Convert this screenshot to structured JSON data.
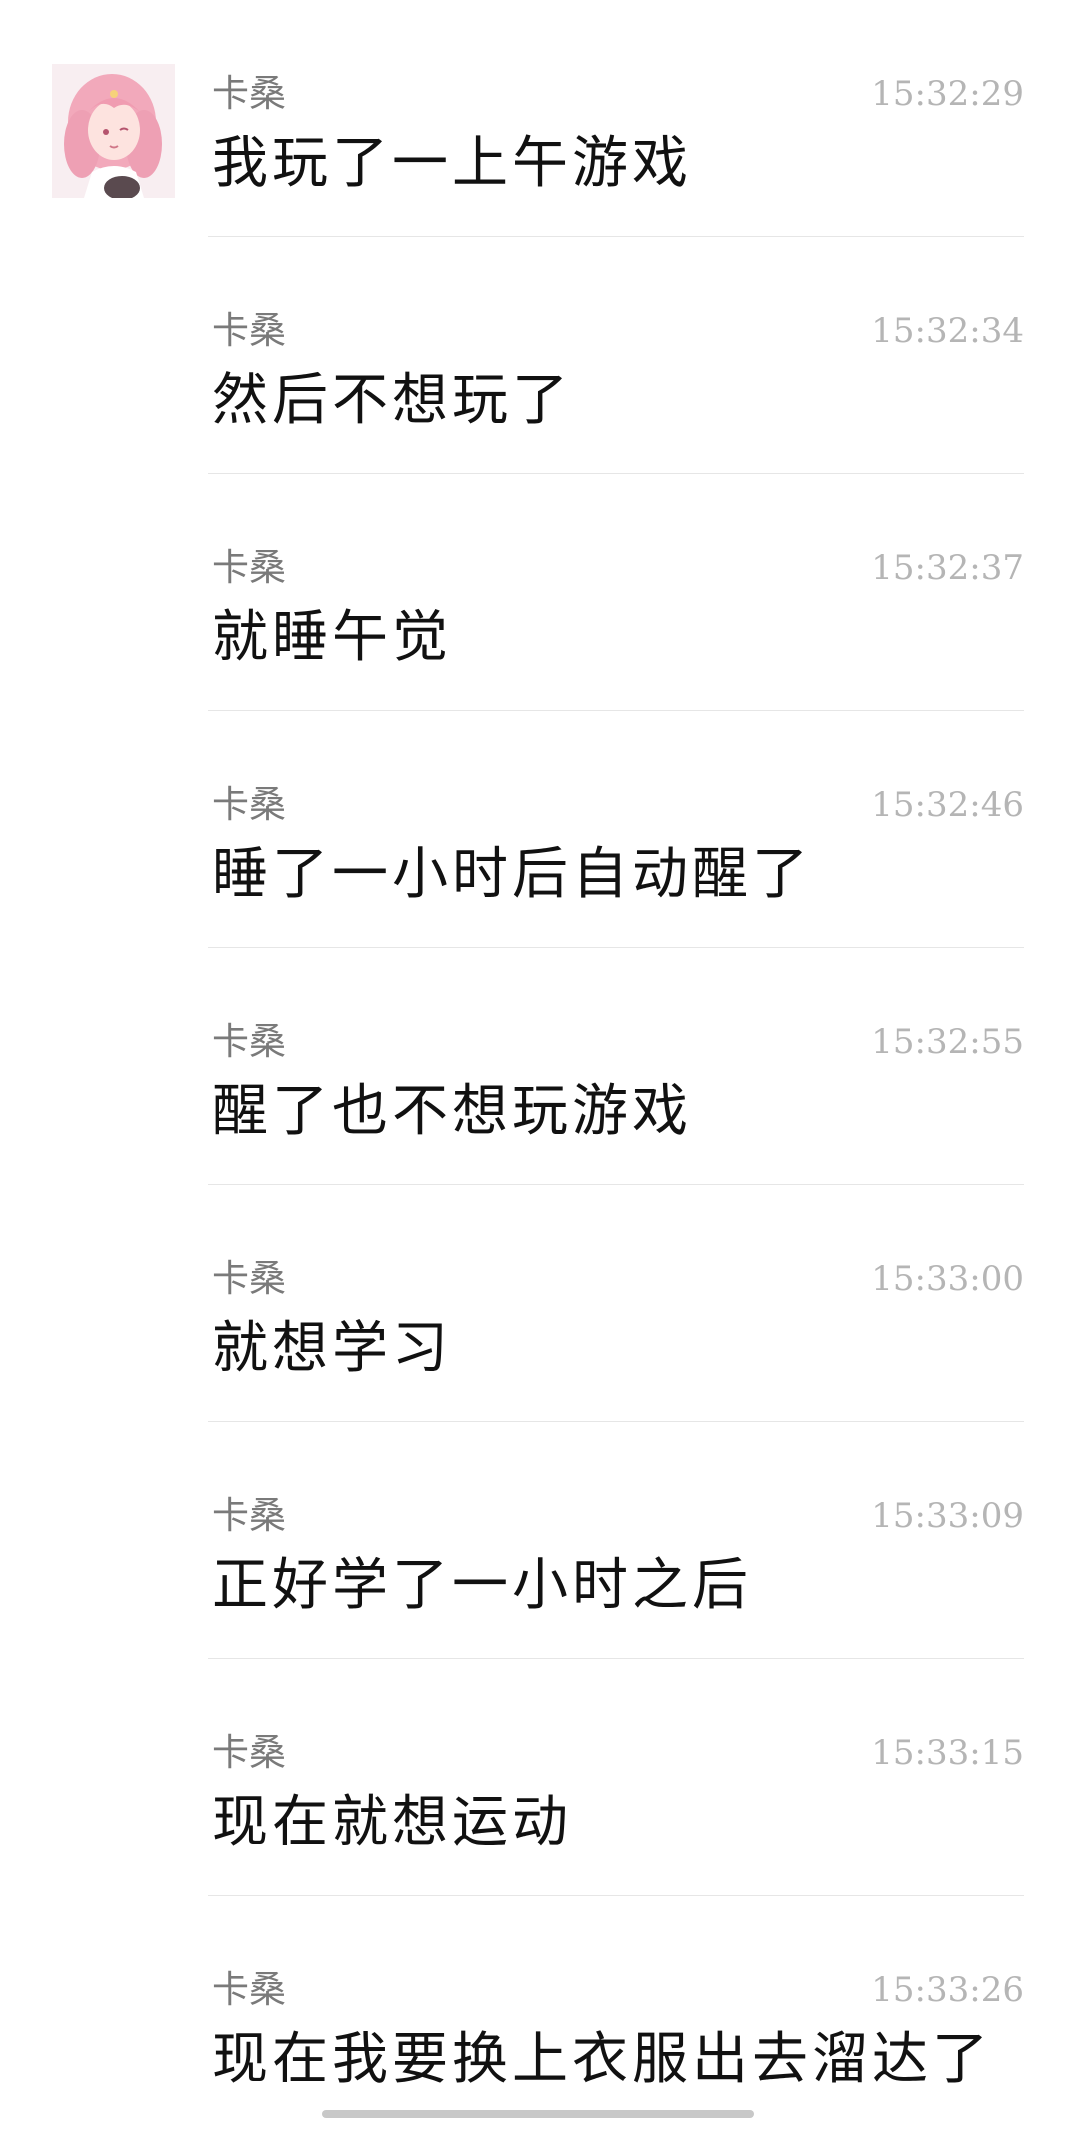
{
  "messages": [
    {
      "sender": "卡桑",
      "time": "15:32:29",
      "text": "我玩了一上午游戏",
      "show_avatar": true
    },
    {
      "sender": "卡桑",
      "time": "15:32:34",
      "text": "然后不想玩了",
      "show_avatar": false
    },
    {
      "sender": "卡桑",
      "time": "15:32:37",
      "text": "就睡午觉",
      "show_avatar": false
    },
    {
      "sender": "卡桑",
      "time": "15:32:46",
      "text": "睡了一小时后自动醒了",
      "show_avatar": false
    },
    {
      "sender": "卡桑",
      "time": "15:32:55",
      "text": "醒了也不想玩游戏",
      "show_avatar": false
    },
    {
      "sender": "卡桑",
      "time": "15:33:00",
      "text": "就想学习",
      "show_avatar": false
    },
    {
      "sender": "卡桑",
      "time": "15:33:09",
      "text": "正好学了一小时之后",
      "show_avatar": false
    },
    {
      "sender": "卡桑",
      "time": "15:33:15",
      "text": "现在就想运动",
      "show_avatar": false
    },
    {
      "sender": "卡桑",
      "time": "15:33:26",
      "text": "现在我要换上衣服出去溜达了",
      "show_avatar": false
    }
  ],
  "avatar_icon": "anime-girl-pink-hair-avatar",
  "colors": {
    "sender": "#7a7a7a",
    "time": "#b5b5b5",
    "text": "#111111",
    "divider": "#e6e6e6",
    "background": "#ffffff"
  }
}
